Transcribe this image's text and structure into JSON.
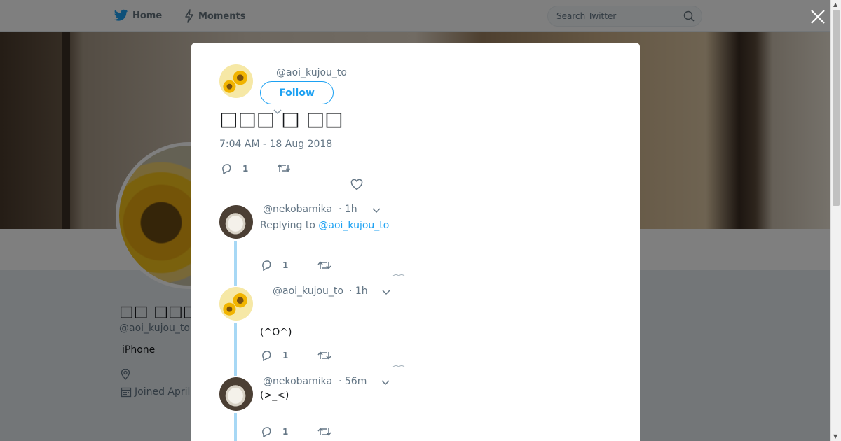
{
  "nav": {
    "home_label": "Home",
    "moments_label": "Moments",
    "search_placeholder": "Search Twitter"
  },
  "profile": {
    "name": "□□ □□□",
    "handle": "@aoi_kujou_to",
    "bio": "iPhone",
    "joined": "Joined April"
  },
  "modal": {
    "author_handle": "@aoi_kujou_to",
    "follow_label": "Follow",
    "tweet_text": "□□□ □ □□",
    "timestamp": "7:04 AM - 18 Aug 2018",
    "reply_count": "1",
    "replies": [
      {
        "handle": "@nekobamika",
        "time": "· 1h",
        "replying_prefix": "Replying to ",
        "replying_handle": "@aoi_kujou_to",
        "text": "",
        "reply_count": "1"
      },
      {
        "handle": "@aoi_kujou_to",
        "time": "· 1h",
        "text": "(^O^)",
        "reply_count": "1"
      },
      {
        "handle": "@nekobamika",
        "time": "· 56m",
        "text": "(>_<)",
        "reply_count": "1"
      }
    ]
  }
}
